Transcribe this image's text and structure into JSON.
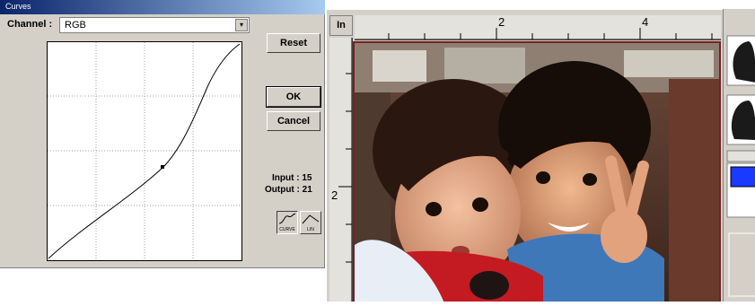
{
  "curves_dialog": {
    "title": "Curves",
    "channel_label": "Channel :",
    "channel_value": "RGB",
    "reset_label": "Reset",
    "ok_label": "OK",
    "cancel_label": "Cancel",
    "input_text": "Input : 15",
    "output_text": "Output : 21",
    "curve_mode_label": "CURVE",
    "linear_mode_label": "LIN"
  },
  "preview": {
    "unit_label": "In",
    "ruler_top_labels": [
      "2",
      "4"
    ],
    "ruler_left_labels": [
      "2"
    ]
  },
  "colors": {
    "title_bar": "#0a246a",
    "selection_blue": "#1a3aff",
    "photo_border": "#7a2020"
  }
}
